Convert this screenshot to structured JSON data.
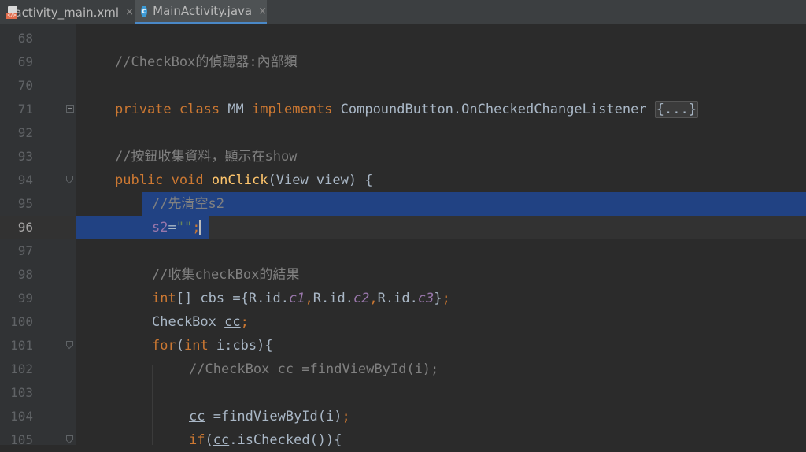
{
  "tabs": [
    {
      "name": "activity_main.xml",
      "icon": "xml-file-icon",
      "active": false
    },
    {
      "name": "MainActivity.java",
      "icon": "java-class-icon",
      "active": true
    }
  ],
  "class_icon_letter": "c",
  "xml_badge": "</>",
  "close_glyph": "×",
  "colors": {
    "background": "#2b2b2b",
    "selection": "#214283",
    "keyword": "#cc7832",
    "comment": "#808080",
    "method": "#ffc66d",
    "field": "#9876aa",
    "string": "#6a8759",
    "text": "#a9b7c6"
  },
  "current_line": "96",
  "lines": [
    {
      "num": "68",
      "parts": []
    },
    {
      "num": "69",
      "parts": [
        {
          "t": "//CheckBox的偵聽器:內部類",
          "c": "cm"
        }
      ]
    },
    {
      "num": "70",
      "parts": []
    },
    {
      "num": "71",
      "parts": [
        {
          "t": "private ",
          "c": "kw"
        },
        {
          "t": "class ",
          "c": "kw"
        },
        {
          "t": "MM ",
          "c": ""
        },
        {
          "t": "implements ",
          "c": "kw"
        },
        {
          "t": "CompoundButton.OnCheckedChangeListener ",
          "c": ""
        },
        {
          "t": "{...}",
          "c": "fold-txt"
        }
      ]
    },
    {
      "num": "92",
      "parts": []
    },
    {
      "num": "93",
      "parts": [
        {
          "t": "//按鈕收集資料，顯示在show",
          "c": "cm"
        }
      ]
    },
    {
      "num": "94",
      "parts": [
        {
          "t": "public ",
          "c": "kw"
        },
        {
          "t": "void ",
          "c": "kw"
        },
        {
          "t": "onClick",
          "c": "fn"
        },
        {
          "t": "(View view) {",
          "c": ""
        }
      ]
    },
    {
      "num": "95",
      "parts": [
        {
          "t": "//先清空s2",
          "c": "cm"
        }
      ]
    },
    {
      "num": "96",
      "parts": [
        {
          "t": "s2",
          "c": "fld"
        },
        {
          "t": "=",
          "c": ""
        },
        {
          "t": "\"\"",
          "c": "str"
        },
        {
          "t": ";",
          "c": "kw"
        }
      ]
    },
    {
      "num": "97",
      "parts": []
    },
    {
      "num": "98",
      "parts": [
        {
          "t": "//收集checkBox的結果",
          "c": "cm"
        }
      ]
    },
    {
      "num": "99",
      "parts": [
        {
          "t": "int",
          "c": "kw"
        },
        {
          "t": "[] cbs ={R.id.",
          "c": ""
        },
        {
          "t": "c1",
          "c": "fldi"
        },
        {
          "t": ",",
          "c": "kw"
        },
        {
          "t": "R.id.",
          "c": ""
        },
        {
          "t": "c2",
          "c": "fldi"
        },
        {
          "t": ",",
          "c": "kw"
        },
        {
          "t": "R.id.",
          "c": ""
        },
        {
          "t": "c3",
          "c": "fldi"
        },
        {
          "t": "}",
          "c": ""
        },
        {
          "t": ";",
          "c": "kw"
        }
      ]
    },
    {
      "num": "100",
      "parts": [
        {
          "t": "CheckBox ",
          "c": ""
        },
        {
          "t": "cc",
          "c": "ul"
        },
        {
          "t": ";",
          "c": "kw"
        }
      ]
    },
    {
      "num": "101",
      "parts": [
        {
          "t": "for",
          "c": "kw"
        },
        {
          "t": "(",
          "c": ""
        },
        {
          "t": "int ",
          "c": "kw"
        },
        {
          "t": "i:cbs){",
          "c": ""
        }
      ]
    },
    {
      "num": "102",
      "parts": [
        {
          "t": "//CheckBox cc =findViewById(i);",
          "c": "cm"
        }
      ]
    },
    {
      "num": "103",
      "parts": []
    },
    {
      "num": "104",
      "parts": [
        {
          "t": "cc",
          "c": "ul"
        },
        {
          "t": " =findViewById(i)",
          "c": ""
        },
        {
          "t": ";",
          "c": "kw"
        }
      ]
    },
    {
      "num": "105",
      "parts": [
        {
          "t": "if",
          "c": "kw"
        },
        {
          "t": "(",
          "c": ""
        },
        {
          "t": "cc",
          "c": "ul"
        },
        {
          "t": ".isChecked()){",
          "c": ""
        }
      ]
    }
  ]
}
